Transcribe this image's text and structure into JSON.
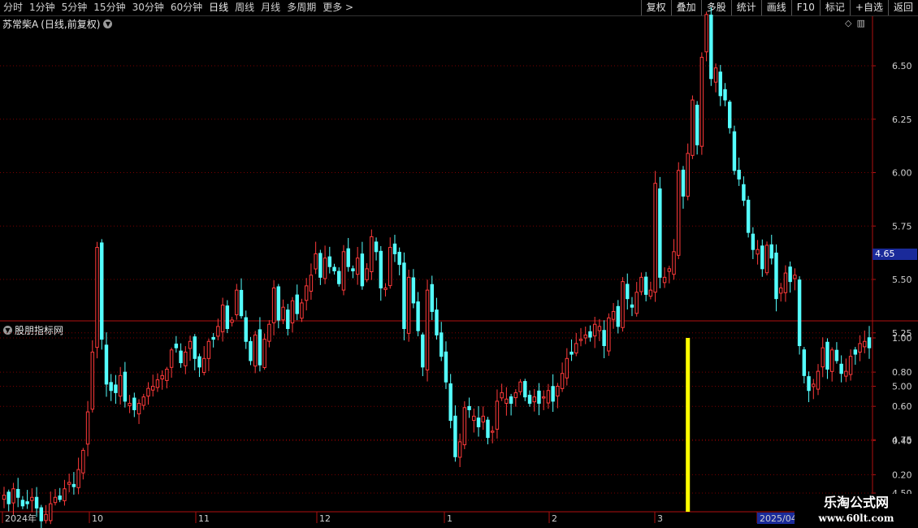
{
  "toolbar": {
    "periods": [
      "分时",
      "1分钟",
      "5分钟",
      "15分钟",
      "30分钟",
      "60分钟",
      "日线",
      "周线",
      "月线",
      "多周期",
      "更多 >"
    ],
    "active_period": "日线",
    "right_buttons": [
      "复权",
      "叠加",
      "多股",
      "统计",
      "画线",
      "F10",
      "标记",
      "+自选",
      "返回"
    ]
  },
  "stock": {
    "name": "苏常柴A",
    "mode": "(日线,前复权)",
    "last_price_label": "4.65"
  },
  "indicator": {
    "name": "股朋指标网"
  },
  "watermark": {
    "title": "乐淘公式网",
    "url": "www.60lt.com"
  },
  "colors": {
    "up": "#ff3a3a",
    "down": "#54ffff",
    "grid": "#7a0000",
    "axis": "#b01010",
    "signal": "#ffff00"
  },
  "chart_data": [
    {
      "type": "candlestick",
      "series": "苏常柴A",
      "y_ticks": [
        "6.50",
        "6.25",
        "6.00",
        "5.75",
        "5.50",
        "5.25",
        "5.00",
        "4.75",
        "4.50"
      ],
      "y_tick_values": [
        6.5,
        6.25,
        6.0,
        5.75,
        5.5,
        5.25,
        5.0,
        4.75,
        4.5
      ],
      "y_range": [
        4.2,
        6.8
      ],
      "x_labels": [
        "2024年",
        "10",
        "11",
        "12",
        "1",
        "2",
        "3",
        "2025/04"
      ],
      "closes": [
        4.49,
        4.45,
        4.52,
        4.48,
        4.44,
        4.45,
        4.48,
        4.43,
        4.37,
        4.4,
        4.45,
        4.48,
        4.47,
        4.52,
        4.55,
        4.53,
        4.61,
        4.7,
        4.88,
        5.16,
        5.65,
        5.22,
        5.01,
        4.98,
        4.97,
        5.05,
        4.93,
        4.92,
        4.89,
        4.92,
        4.95,
        4.99,
        5.0,
        5.03,
        5.05,
        5.08,
        5.17,
        5.18,
        5.11,
        5.16,
        5.21,
        5.13,
        5.09,
        5.13,
        5.21,
        5.22,
        5.28,
        5.38,
        5.27,
        5.31,
        5.45,
        5.33,
        5.21,
        5.12,
        5.24,
        5.1,
        5.22,
        5.29,
        5.46,
        5.31,
        5.37,
        5.27,
        5.4,
        5.34,
        5.39,
        5.47,
        5.52,
        5.62,
        5.51,
        5.6,
        5.56,
        5.54,
        5.48,
        5.63,
        5.56,
        5.54,
        5.6,
        5.47,
        5.55,
        5.7,
        5.63,
        5.46,
        5.46,
        5.65,
        5.62,
        5.57,
        5.27,
        5.51,
        5.39,
        5.26,
        5.09,
        5.45,
        5.35,
        5.24,
        5.14,
        5.02,
        4.84,
        4.67,
        4.74,
        4.9,
        4.89,
        4.86,
        4.81,
        4.86,
        4.76,
        4.79,
        4.93,
        4.97,
        4.94,
        4.92,
        4.97,
        5.02,
        4.95,
        4.92,
        4.95,
        4.92,
        4.95,
        4.98,
        4.93,
        5.0,
        5.06,
        5.13,
        5.15,
        5.2,
        5.22,
        5.24,
        5.23,
        5.29,
        5.28,
        5.19,
        5.32,
        5.35,
        5.28,
        5.49,
        5.41,
        5.37,
        5.44,
        5.51,
        5.43,
        5.45,
        5.95,
        5.51,
        5.51,
        5.55,
        5.63,
        6.01,
        5.89,
        6.09,
        6.34,
        6.13,
        6.54,
        6.74,
        6.44,
        6.49,
        6.36,
        6.34,
        6.21,
        6.01,
        5.97,
        5.87,
        5.72,
        5.64,
        5.64,
        5.55,
        5.66,
        5.6,
        5.41,
        5.46,
        5.53,
        5.49,
        5.52,
        5.19,
        5.05,
        4.98,
        5.01,
        5.07,
        5.18,
        5.08,
        5.17,
        5.12,
        5.06,
        5.07,
        5.14,
        5.15,
        5.2,
        5.21,
        5.18
      ]
    },
    {
      "type": "bar",
      "series": "股朋指标网",
      "y_ticks": [
        "1.00",
        "0.80",
        "0.60",
        "0.40",
        "0.20"
      ],
      "y_tick_values": [
        1.0,
        0.8,
        0.6,
        0.4,
        0.2
      ],
      "y_range": [
        0,
        1.0
      ],
      "signal_index": 147,
      "signal_value": 1.0
    }
  ]
}
